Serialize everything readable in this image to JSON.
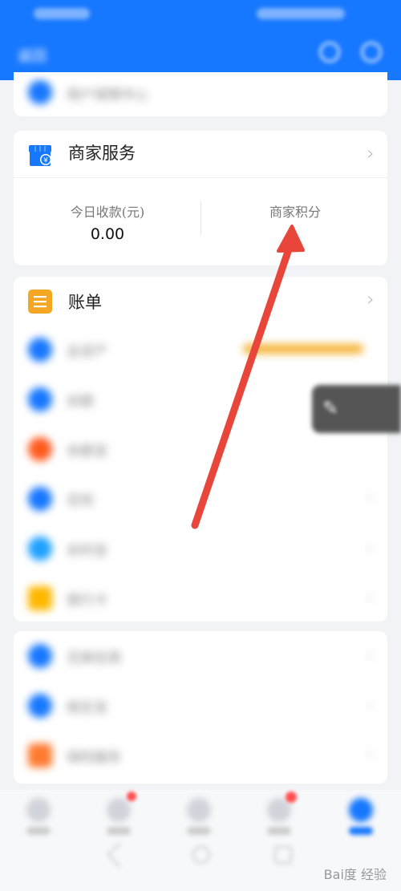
{
  "header": {
    "title": "返回"
  },
  "top_partial": {
    "label": "用户保障中心"
  },
  "merchant": {
    "title": "商家服务",
    "stats": [
      {
        "label": "今日收款(元)",
        "value": "0.00"
      },
      {
        "label": "商家积分",
        "value": ""
      }
    ]
  },
  "bill": {
    "title": "账单"
  },
  "list1": [
    {
      "label": "总资产",
      "note": "",
      "color": "#1677ff"
    },
    {
      "label": "余额",
      "color": "#1677ff"
    },
    {
      "label": "余额宝",
      "color": "#ff5a1f"
    },
    {
      "label": "花呗",
      "color": "#1677ff"
    },
    {
      "label": "余利宝",
      "color": "#1ea0ff"
    },
    {
      "label": "银行卡",
      "color": "#ffb800"
    }
  ],
  "list2": [
    {
      "label": "芝麻信用",
      "color": "#1677ff"
    },
    {
      "label": "相互宝",
      "color": "#1677ff"
    },
    {
      "label": "保险服务",
      "color": "#ff7a2f"
    }
  ],
  "colors": {
    "primary": "#1677ff",
    "arrow": "#e8463a",
    "bill_icon": "#f5a623"
  },
  "watermark": "Bai度 经验"
}
